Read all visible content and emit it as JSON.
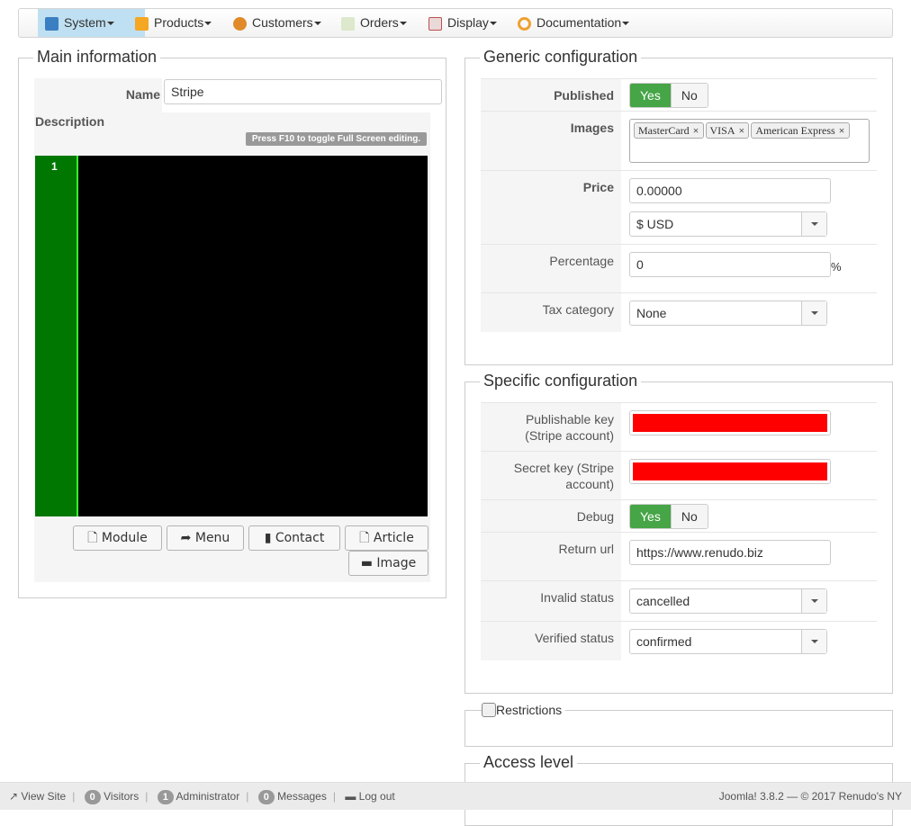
{
  "nav": {
    "items": [
      {
        "label": "System",
        "icon": "tools-icon",
        "color": "#3a7fc1"
      },
      {
        "label": "Products",
        "icon": "box-icon",
        "color": "#f5a623"
      },
      {
        "label": "Customers",
        "icon": "users-icon",
        "color": "#e08a2a"
      },
      {
        "label": "Orders",
        "icon": "orders-icon",
        "color": "#8fbf5f"
      },
      {
        "label": "Display",
        "icon": "display-icon",
        "color": "#c0504d"
      },
      {
        "label": "Documentation",
        "icon": "lifebuoy-icon",
        "color": "#f0a030"
      }
    ]
  },
  "main": {
    "legend": "Main information",
    "name_label": "Name",
    "name_value": "Stripe",
    "description_label": "Description",
    "editor_hint": "Press F10 to toggle Full Screen editing.",
    "line_number": "1",
    "buttons": {
      "module": "Module",
      "menu": "Menu",
      "contact": "Contact",
      "article": "Article",
      "image": "Image"
    }
  },
  "generic": {
    "legend": "Generic configuration",
    "published_label": "Published",
    "yes": "Yes",
    "no": "No",
    "images_label": "Images",
    "images": [
      "MasterCard",
      "VISA",
      "American Express"
    ],
    "price_label": "Price",
    "price_value": "0.00000",
    "currency": "$ USD",
    "percentage_label": "Percentage",
    "percentage_value": "0",
    "percent_sign": "%",
    "tax_label": "Tax category",
    "tax_value": "None"
  },
  "specific": {
    "legend": "Specific configuration",
    "pub_key_label": "Publishable key (Stripe account)",
    "secret_key_label": "Secret key (Stripe account)",
    "debug_label": "Debug",
    "yes": "Yes",
    "no": "No",
    "return_label": "Return url",
    "return_value": "https://www.renudo.biz",
    "invalid_label": "Invalid status",
    "invalid_value": "cancelled",
    "verified_label": "Verified status",
    "verified_value": "confirmed",
    "redacted_color": "#ff0000"
  },
  "restrictions": {
    "label": "Restrictions"
  },
  "access": {
    "legend": "Access level"
  },
  "footer": {
    "view_site": "View Site",
    "visitors_count": "0",
    "visitors": "Visitors",
    "admin_count": "1",
    "admin": "Administrator",
    "messages_count": "0",
    "messages": "Messages",
    "logout": "Log out",
    "version": "Joomla! 3.8.2  —  © 2017 Renudo's NY"
  }
}
